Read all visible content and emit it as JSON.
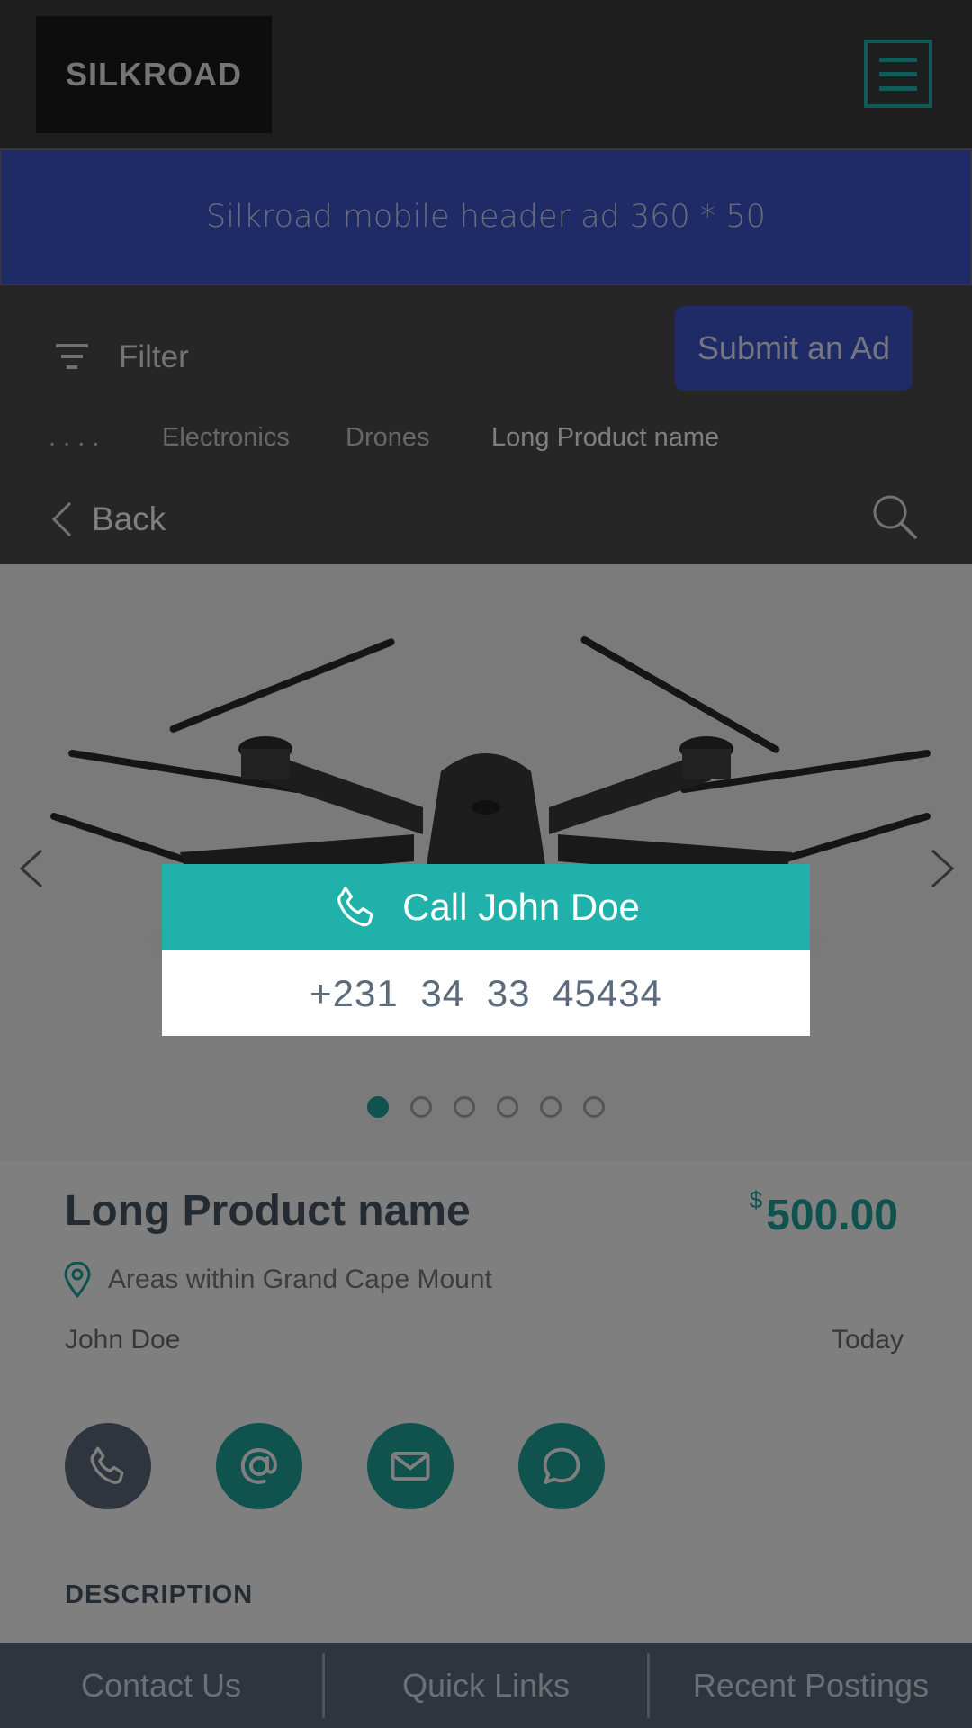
{
  "header": {
    "logo_text": "SILKROAD",
    "menu_icon": "hamburger-menu-icon"
  },
  "ad_banner": {
    "text": "Silkroad mobile header ad 360 * 50"
  },
  "toolbar": {
    "filter_label": "Filter",
    "submit_label": "Submit an Ad"
  },
  "breadcrumb": {
    "items": [
      ". . . .",
      "Electronics",
      "Drones",
      "Long Product name"
    ]
  },
  "nav": {
    "back_label": "Back"
  },
  "gallery": {
    "image_subject": "drone",
    "total_images": 6,
    "active_index": 1
  },
  "product": {
    "name": "Long Product name",
    "currency_symbol": "$",
    "price": "500.00",
    "location": "Areas within Grand Cape Mount",
    "seller": "John Doe",
    "posted": "Today",
    "description_heading": "DESCRIPTION"
  },
  "contact_buttons": [
    "phone-icon",
    "at-sign-icon",
    "mail-icon",
    "chat-icon"
  ],
  "modal": {
    "title": "Call John Doe",
    "phone": "+231 34 33 45434"
  },
  "footer": {
    "links": [
      "Contact Us",
      "Quick Links",
      "Recent Postings"
    ]
  },
  "colors": {
    "accent": "#20b2aa",
    "brand_blue": "#3f56cc",
    "dark_header": "#3d3d3d",
    "slate": "#5d6a7e"
  }
}
